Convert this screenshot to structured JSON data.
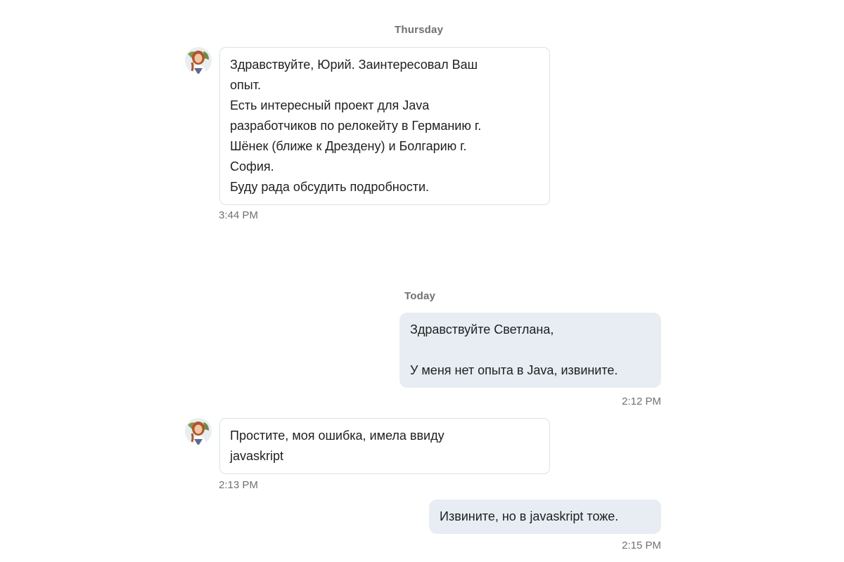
{
  "day_separators": {
    "first": "Thursday",
    "second": "Today"
  },
  "messages": [
    {
      "direction": "incoming",
      "avatar_icon": "person-photo-icon",
      "lines": [
        "Здравствуйте, Юрий. Заинтересовал Ваш",
        "опыт.",
        "Есть интересный проект для Java",
        "разработчиков по релокейту в Германию г.",
        "Шёнек (ближе к Дрездену) и Болгарию г.",
        "София.",
        "Буду рада обсудить подробности."
      ],
      "time": "3:44 PM"
    },
    {
      "direction": "outgoing",
      "lines": [
        "Здравствуйте Светлана,",
        "",
        "У меня нет опыта в Java, извините."
      ],
      "time": "2:12 PM"
    },
    {
      "direction": "incoming",
      "avatar_icon": "person-photo-icon",
      "lines": [
        "Простите, моя ошибка, имела ввиду",
        "javaskript"
      ],
      "time": "2:13 PM"
    },
    {
      "direction": "outgoing",
      "lines": [
        "Извините, но в javaskript тоже."
      ],
      "time": "2:15 PM"
    }
  ],
  "colors": {
    "incoming_bubble_bg": "#ffffff",
    "incoming_bubble_border": "#dde2e7",
    "outgoing_bubble_bg": "#e7edf2",
    "meta_text": "#707070",
    "message_text": "#1f1f1f"
  }
}
